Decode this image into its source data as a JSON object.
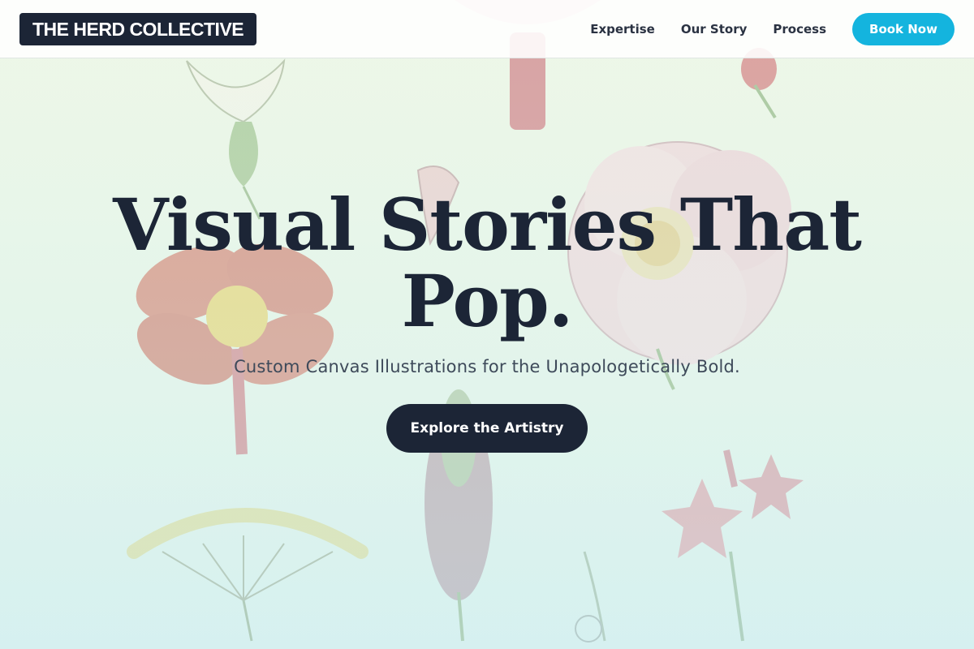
{
  "brand": {
    "logo_text": "THE HERD COLLECTIVE"
  },
  "nav": {
    "links": [
      {
        "label": "Expertise"
      },
      {
        "label": "Our Story"
      },
      {
        "label": "Process"
      }
    ],
    "book_label": "Book Now"
  },
  "hero": {
    "title_line1": "Visual Stories That",
    "title_line2": "Pop.",
    "subtitle": "Custom Canvas Illustrations for the Unapologetically Bold.",
    "cta_label": "Explore the Artistry"
  },
  "colors": {
    "dark_navy": "#1c2536",
    "accent_cyan": "#14b4de",
    "background_mint": "#e4f4e8"
  },
  "icons": [
    "botanical-illustration-background"
  ]
}
